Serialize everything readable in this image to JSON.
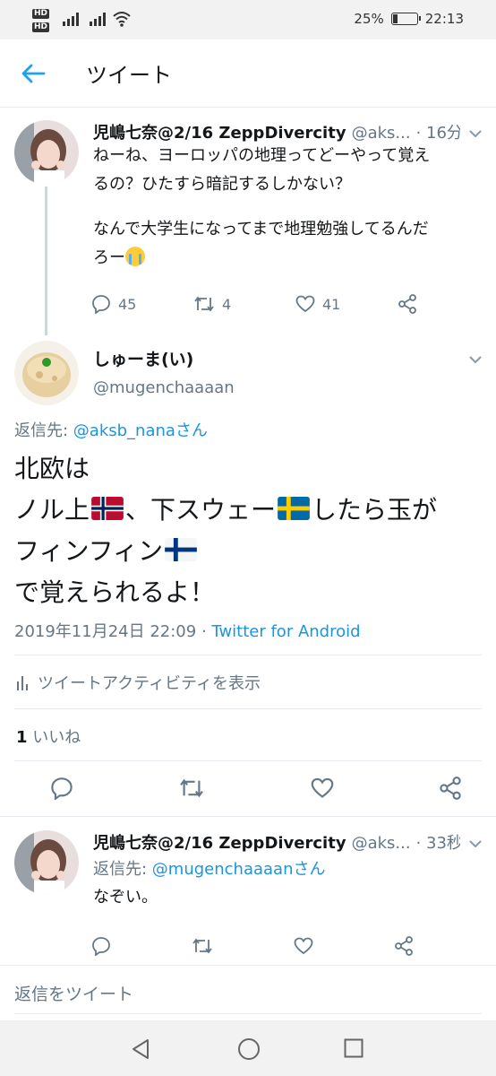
{
  "status_bar": {
    "hd1": "HD",
    "hd2": "HD",
    "battery": "25%",
    "battery_level": 0.25,
    "time": "22:13"
  },
  "header": {
    "title": "ツイート",
    "back_icon": "arrow-left-icon"
  },
  "tweets": [
    {
      "name": "児嶋七奈@2/16 ZeppDivercity",
      "handle": "@aks...",
      "time": "· 16分",
      "text_line1": "ねーね、ヨーロッパの地理ってどーやって覚え",
      "text_line2": "るの？ひたすら暗記するしかない？",
      "text_line3": "なんで大学生になってまで地理勉強してるんだ",
      "text_line4": "ろー",
      "reply_count": "45",
      "retweet_count": "4",
      "like_count": "41"
    },
    {
      "name": "児嶋七奈@2/16 ZeppDivercity",
      "handle": "@aks...",
      "time": "· 33秒",
      "reply_prefix": "返信先: ",
      "reply_to": "@mugenchaaaanさん",
      "text": "なぞい。"
    }
  ],
  "main_tweet": {
    "name": "しゅーま(い)",
    "handle": "@mugenchaaaan",
    "reply_prefix": "返信先: ",
    "reply_to": "@aksb_nanaさん",
    "line1": "北欧は",
    "line2a": "ノル上",
    "line2b": "、下スウェー",
    "line2c": "したら玉が",
    "line3": "フィンフィン",
    "line4": "で覚えられるよ！",
    "date": "2019年11月24日 22:09",
    "separator": "·",
    "source": "Twitter for Android",
    "activity": "ツイートアクティビティを表示",
    "likes_count": "1",
    "likes_label": "いいね"
  },
  "reply_box": {
    "placeholder": "返信をツイート"
  },
  "colors": {
    "accent": "#1b95e0",
    "secondary_text": "#657786",
    "divider": "#e6ecf0"
  }
}
